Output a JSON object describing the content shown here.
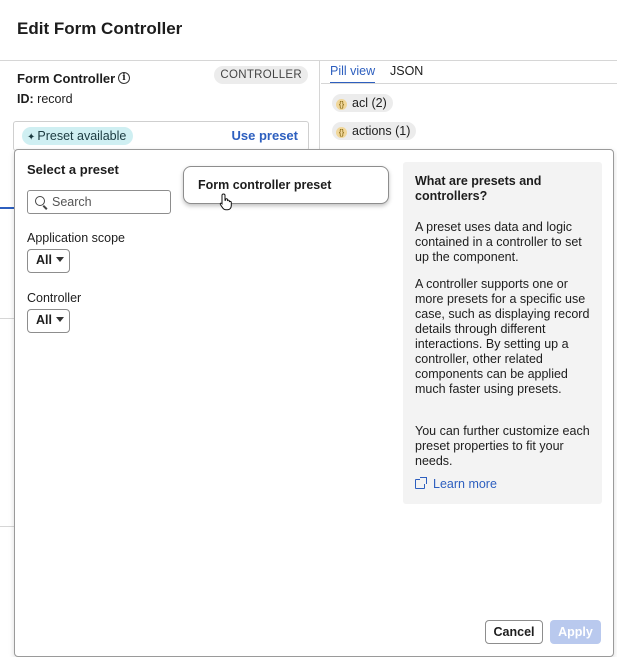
{
  "dialog": {
    "title": "Edit Form Controller"
  },
  "controller": {
    "name": "Form Controller",
    "badge": "CONTROLLER",
    "id_label": "ID:",
    "id_value": "record"
  },
  "preset_bar": {
    "status": "Preset available",
    "action": "Use preset"
  },
  "view_tabs": {
    "pill_view": "Pill view",
    "json": "JSON",
    "active": "Pill view"
  },
  "pills": [
    {
      "label": "acl",
      "count": "(2)"
    },
    {
      "label": "actions",
      "count": "(1)"
    }
  ],
  "popover": {
    "title": "Select a preset",
    "search": {
      "placeholder": "Search",
      "value": ""
    },
    "filters": [
      {
        "label": "Application scope",
        "value": "All"
      },
      {
        "label": "Controller",
        "value": "All"
      }
    ],
    "results": [
      {
        "label": "Form controller preset"
      }
    ],
    "info": {
      "title": "What are presets and controllers?",
      "paragraphs": [
        "A preset uses data and logic contained in a controller to set up the component.",
        "A controller supports one or more presets for a specific use case, such as displaying record details through different interactions. By setting up a controller, other related components can be applied much faster using presets.",
        "You can further customize each preset properties to fit your needs."
      ],
      "link": "Learn more"
    },
    "buttons": {
      "cancel": "Cancel",
      "apply": "Apply"
    }
  },
  "colors": {
    "accent": "#2d5fbf",
    "preset_pill_bg": "#cfeff2",
    "apply_disabled": "#b9c9ee",
    "info_panel_bg": "#f3f3f3"
  },
  "icons": [
    "info-icon",
    "magic-wand-icon",
    "braces-icon",
    "search-icon",
    "caret-down-icon",
    "pointer-cursor-icon",
    "external-link-icon"
  ]
}
